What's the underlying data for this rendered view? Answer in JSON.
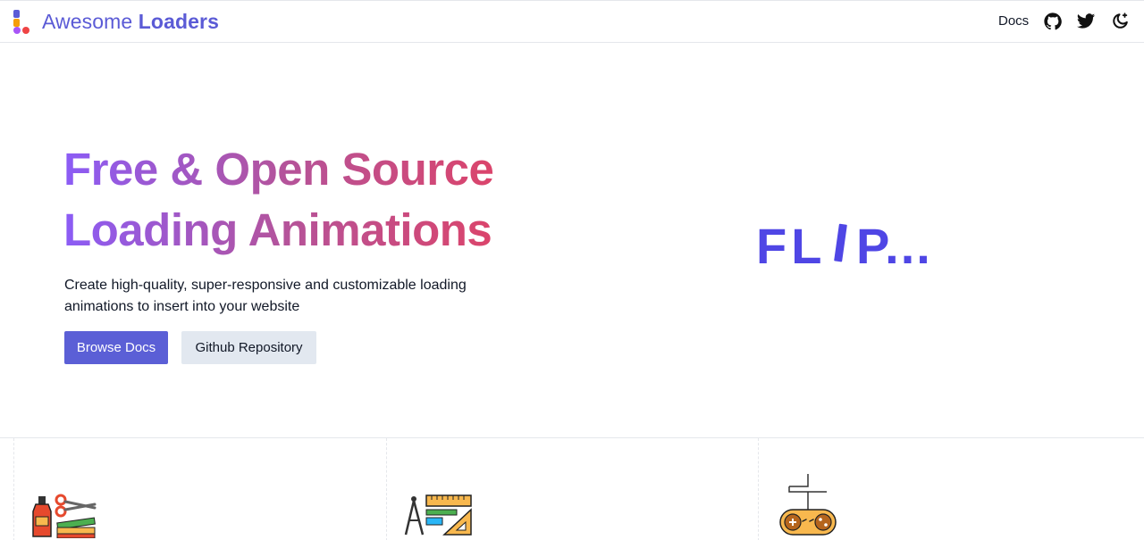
{
  "header": {
    "brand_light": "Awesome",
    "brand_bold": "Loaders",
    "nav": {
      "docs_label": "Docs"
    },
    "icons": [
      "github-icon",
      "twitter-icon",
      "theme-toggle-icon"
    ]
  },
  "hero": {
    "title_line_1": "Free & Open Source",
    "title_line_2": "Loading Animations",
    "subtitle": "Create high-quality, super-responsive and customizable loading animations to insert into your website",
    "primary_button": "Browse Docs",
    "secondary_button": "Github Repository"
  },
  "loader": {
    "text": "FLIP...",
    "color": "#4f46e5"
  },
  "features": [
    {
      "icon": "art-supplies-icon"
    },
    {
      "icon": "drafting-tools-icon"
    },
    {
      "icon": "game-controller-icon"
    }
  ],
  "colors": {
    "brand": "#5b5bd6",
    "gradient_start": "#8b5cf6",
    "gradient_end": "#e83f5b",
    "primary_button": "#5b5fd6",
    "secondary_button": "#e2e8f0"
  }
}
